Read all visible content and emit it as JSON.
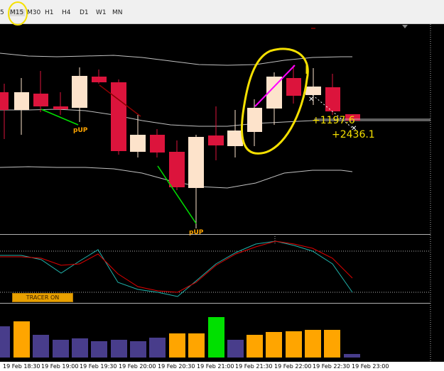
{
  "toolbar": {
    "timeframes": [
      {
        "label": "5",
        "active": false
      },
      {
        "label": "M15",
        "active": true
      },
      {
        "label": "M30",
        "active": false
      },
      {
        "label": "H1",
        "active": false
      },
      {
        "label": "H4",
        "active": false
      },
      {
        "label": "D1",
        "active": false
      },
      {
        "label": "W1",
        "active": false
      },
      {
        "label": "MN",
        "active": false
      }
    ]
  },
  "annotations": {
    "pup_left": "pUP",
    "pup_bottom": "pUP",
    "profit_1": "+1197.6",
    "profit_2": "+2436.1"
  },
  "indicator": {
    "tracer_label": "TRACER ON"
  },
  "time_axis": {
    "labels": [
      "19 Feb 18:30",
      "19 Feb 19:00",
      "19 Feb 19:30",
      "19 Feb 20:00",
      "19 Feb 20:30",
      "19 Feb 21:00",
      "19 Feb 21:30",
      "19 Feb 22:00",
      "19 Feb 22:30",
      "19 Feb 23:00"
    ]
  },
  "colors": {
    "bull_candle": "#fde3cb",
    "bear_candle": "#dc143c",
    "band": "#c0c0c0",
    "osc_fast": "#20b2aa",
    "osc_slow": "#e00000",
    "hist_orange": "#ffa500",
    "hist_purple": "#483d8b",
    "hist_green": "#00e000",
    "highlight_circle": "#f5e000",
    "pattern_line": "#ff00ff"
  }
}
